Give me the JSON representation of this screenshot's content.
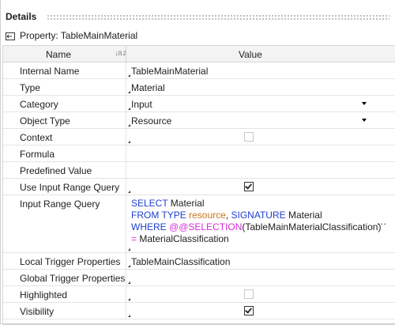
{
  "details": {
    "title": "Details",
    "property_label": "Property: TableMainMaterial"
  },
  "grid": {
    "col_name": "Name",
    "col_value": "Value",
    "rows": [
      {
        "name": "Internal Name",
        "value": "TableMainMaterial"
      },
      {
        "name": "Type",
        "value": "Material"
      },
      {
        "name": "Category",
        "value": "Input",
        "dropdown": true
      },
      {
        "name": "Object Type",
        "value": "Resource",
        "dropdown": true
      },
      {
        "name": "Context",
        "checkbox": false,
        "disabled": true
      },
      {
        "name": "Formula",
        "value": ""
      },
      {
        "name": "Predefined Value",
        "value": ""
      },
      {
        "name": "Use Input Range Query",
        "checkbox": true
      },
      {
        "name": "Input Range Query"
      },
      {
        "name": "Local Trigger Properties",
        "value": "TableMainClassification"
      },
      {
        "name": "Global Trigger Properties",
        "value": ""
      },
      {
        "name": "Highlighted",
        "checkbox": false,
        "disabled": true
      },
      {
        "name": "Visibility",
        "checkbox": true
      }
    ],
    "query": {
      "l1_kw": "SELECT",
      "l1_rest": " Material",
      "l2_kw1": "FROM TYPE",
      "l2_type": " resource",
      "l2_comma": ", ",
      "l2_kw2": "SIGNATURE",
      "l2_rest": " Material",
      "l3_kw": "WHERE",
      "l3_fn": " @@SELECTION",
      "l3_rest": "(TableMainMaterialClassification)",
      "l4_op": "=",
      "l4_rest": " MaterialClassification",
      "more": "..."
    }
  }
}
